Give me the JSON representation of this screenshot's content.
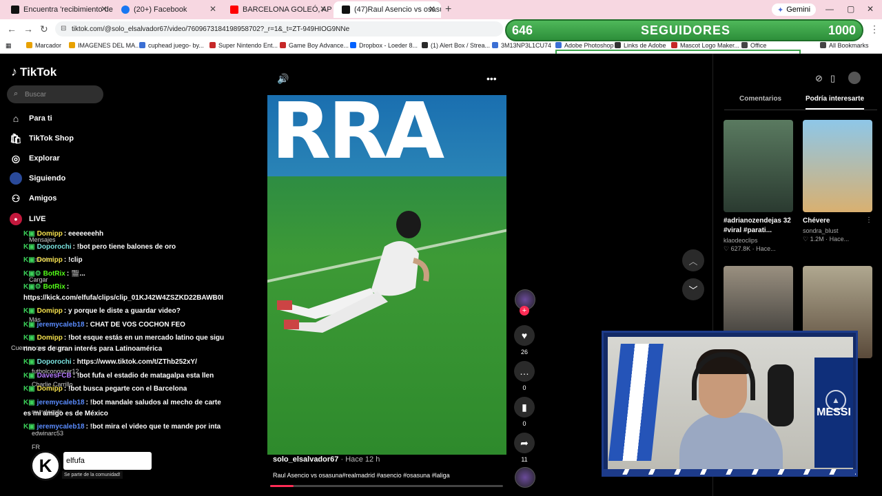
{
  "browser": {
    "tabs": [
      {
        "title": "Encuentra 'recibimiento de sap",
        "color": "#111"
      },
      {
        "title": "(20+) Facebook",
        "color": "#1877f2"
      },
      {
        "title": "BARCELONA GOLEÓ, APROVEC",
        "color": "#ff0000"
      },
      {
        "title": "(47)Raul Asencio vs osasun",
        "color": "#111"
      }
    ],
    "gemini_label": "Gemini",
    "url": "tiktok.com/@solo_elsalvador67/video/7609673184198958702?_r=1&_t=ZT-949HIOG9NNe",
    "bookmarks": [
      "Marcador",
      "IMAGENES DEL MA...",
      "cuphead juego- by...",
      "Super Nintendo Ent...",
      "Game Boy Advance...",
      "Dropbox - Loeder 8...",
      "(1) Alert Box / Strea...",
      "3M13NP3L1CU74",
      "Adobe Photoshop",
      "Links de Adobe",
      "Mascot Logo Maker...",
      "Office",
      "All Bookmarks"
    ]
  },
  "stream_overlay": {
    "followers_count": "646",
    "followers_label": "SEGUIDORES",
    "followers_goal": "1000",
    "kick_channel": "elfufa",
    "kick_subtitle": "Se parte de la comunidad!"
  },
  "tiktok": {
    "logo": "TikTok",
    "search_placeholder": "Buscar",
    "nav": [
      {
        "label": "Para ti",
        "icon": "home-icon"
      },
      {
        "label": "TikTok Shop",
        "icon": "shop-icon"
      },
      {
        "label": "Explorar",
        "icon": "compass-icon"
      },
      {
        "label": "Siguiendo",
        "icon": "following-icon"
      },
      {
        "label": "Amigos",
        "icon": "friends-icon"
      },
      {
        "label": "LIVE",
        "icon": "live-icon"
      }
    ],
    "sidebar_ghosts": [
      "Mensajes",
      "Actividad",
      "Cargar",
      "Más",
      "Cuentas que sigues",
      "futbolconoscar12",
      "Charlie Carrillo",
      "mundoesfs",
      "edwinarc53",
      "FR"
    ],
    "video": {
      "banner_text": "RRA",
      "author": "solo_elsalvador67",
      "time": "Hace 12 h",
      "caption": "Raul Asencio vs osasuna#realmadrid #asencio #osasuna #laliga",
      "progress": 0.1
    },
    "actions": {
      "likes": "26",
      "comments": "0",
      "saves": "0",
      "shares": "11"
    },
    "right_tabs": [
      "Comentarios",
      "Podría interesarte"
    ],
    "cards": [
      {
        "title": "#adrianozendejas 32 #viral #parati...",
        "user": "klaodeoclips",
        "meta": "♡ 627.8K · Hace...",
        "color": "#4a6a58"
      },
      {
        "title": "Chévere",
        "user": "sondra_blust",
        "meta": "♡ 1.2M · Hace...",
        "color": "#c9a56a"
      },
      {
        "title": "",
        "user": "",
        "meta": "",
        "color": "#6a5a48"
      },
      {
        "title": "",
        "user": "",
        "meta": "",
        "color": "#8a7a6a"
      }
    ]
  },
  "chat": [
    {
      "user": "Domipp",
      "msg": ": eeeeeeehh",
      "color": "#f4e04d"
    },
    {
      "user": "Doporochi",
      "msg": ": !bot pero tiene balones de oro",
      "color": "#7ae3e0"
    },
    {
      "user": "Domipp",
      "msg": ": !clip",
      "color": "#f4e04d"
    },
    {
      "user": "BotRix",
      "msg": ": 🎬...",
      "color": "#53fc18"
    },
    {
      "user": "BotRix",
      "msg": ":",
      "color": "#53fc18"
    },
    {
      "user": "",
      "msg": "https://kick.com/elfufa/clips/clip_01KJ42W4ZSZKD22BAWB0I",
      "color": "#fff"
    },
    {
      "user": "Domipp",
      "msg": ": y porque le diste a guardar video?",
      "color": "#f4e04d"
    },
    {
      "user": "jeremycaleb18",
      "msg": ": CHAT DE VOS COCHON FEO",
      "color": "#5a8cff"
    },
    {
      "user": "Domipp",
      "msg": ": !bot esque estás en un mercado latino que sigu",
      "color": "#f4e04d"
    },
    {
      "user": "",
      "msg": "nno es de gran interés para Latinoamérica",
      "color": "#fff"
    },
    {
      "user": "Doporochi",
      "msg": ": https://www.tiktok.com/t/ZThb252xY/",
      "color": "#7ae3e0"
    },
    {
      "user": "DavesFCB",
      "msg": ": !bot fufa el estadio de matagalpa esta llen",
      "color": "#b57bff"
    },
    {
      "user": "Domipp",
      "msg": ": !bot busca pegarte con el Barcelona",
      "color": "#f4e04d"
    },
    {
      "user": "jeremycaleb18",
      "msg": ": !bot mandale saludos al mecho de carte",
      "color": "#5a8cff"
    },
    {
      "user": "",
      "msg": "es mi amigo es de México",
      "color": "#fff"
    },
    {
      "user": "jeremycaleb18",
      "msg": ": !bot mira el video que te mande por inta",
      "color": "#5a8cff"
    }
  ],
  "webcam": {
    "jersey_text": "MESSI"
  }
}
